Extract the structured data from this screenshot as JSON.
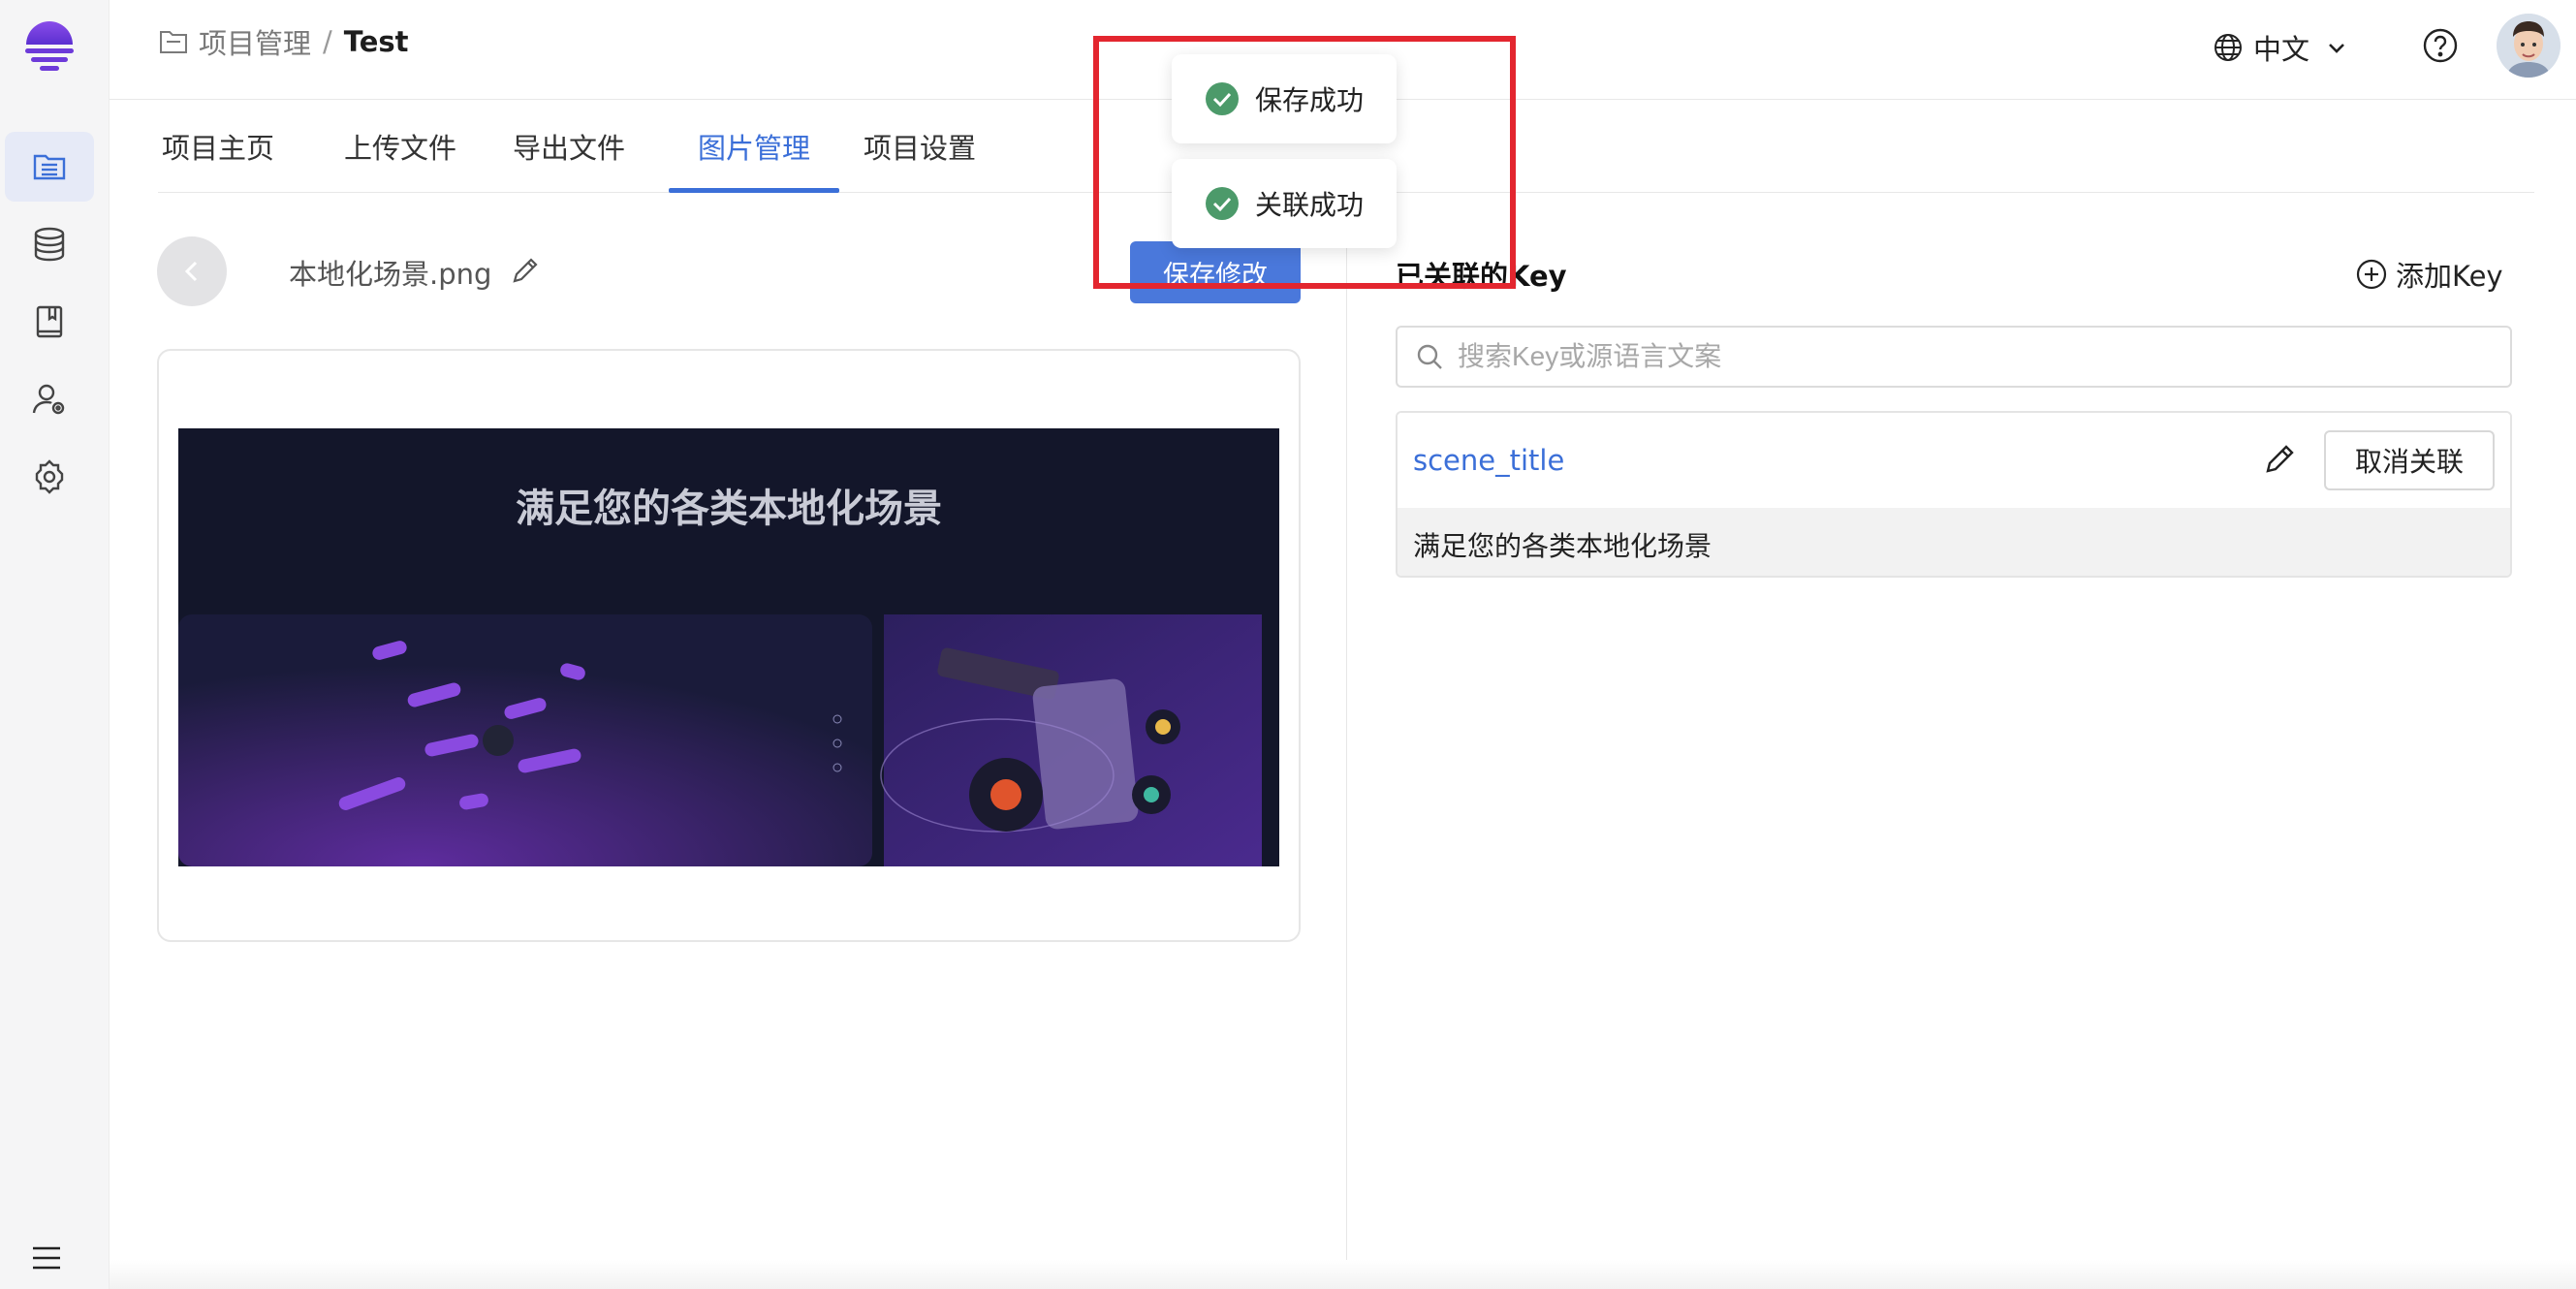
{
  "sidebar": {
    "items": [
      {
        "icon": "project-list-icon",
        "active": true
      },
      {
        "icon": "database-icon",
        "active": false
      },
      {
        "icon": "book-icon",
        "active": false
      },
      {
        "icon": "user-settings-icon",
        "active": false
      },
      {
        "icon": "gear-icon",
        "active": false
      }
    ],
    "menu_icon": "hamburger-menu-icon"
  },
  "header": {
    "breadcrumb": {
      "parent": "项目管理",
      "separator": "/",
      "current": "Test"
    },
    "language": "中文"
  },
  "tabs": [
    {
      "label": "项目主页",
      "active": false
    },
    {
      "label": "上传文件",
      "active": false
    },
    {
      "label": "导出文件",
      "active": false
    },
    {
      "label": "图片管理",
      "active": true
    },
    {
      "label": "项目设置",
      "active": false
    }
  ],
  "image_panel": {
    "file_name": "本地化场景.png",
    "save_label": "保存修改",
    "preview_title": "满足您的各类本地化场景"
  },
  "keys_panel": {
    "title": "已关联的Key",
    "add_label": "添加Key",
    "search_placeholder": "搜索Key或源语言文案",
    "items": [
      {
        "key": "scene_title",
        "unlink_label": "取消关联",
        "text": "满足您的各类本地化场景"
      }
    ]
  },
  "toasts": [
    {
      "message": "保存成功",
      "status": "success"
    },
    {
      "message": "关联成功",
      "status": "success"
    }
  ],
  "colors": {
    "accent": "#3b6fd8",
    "button": "#4a78db",
    "success": "#4c9a6a",
    "annotation": "#e3262f"
  }
}
